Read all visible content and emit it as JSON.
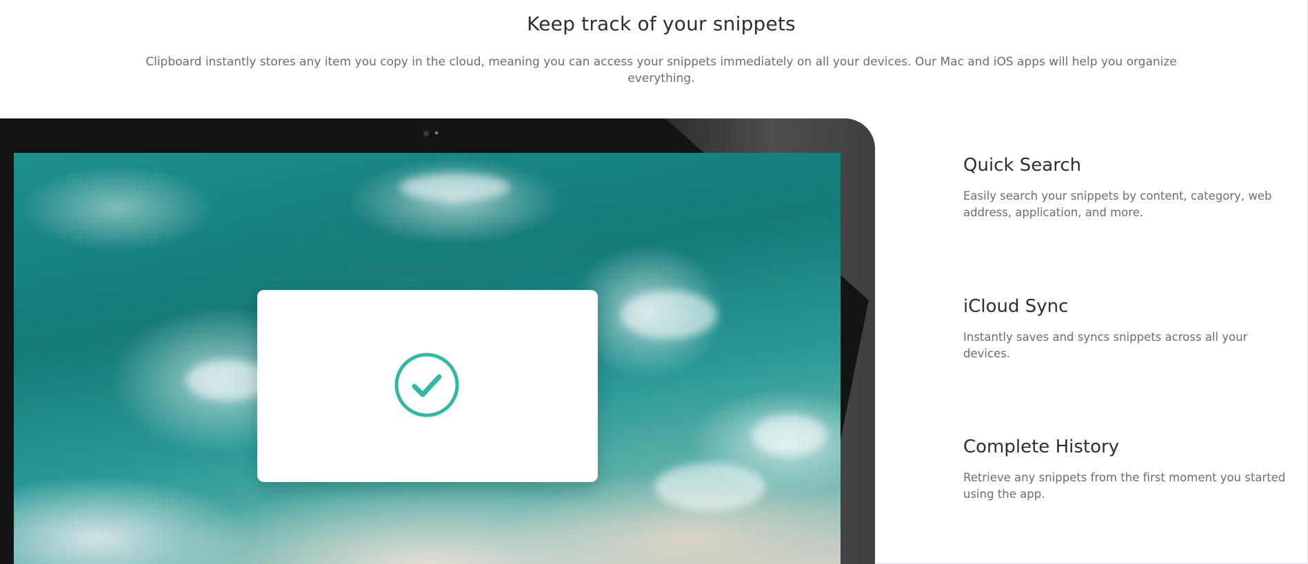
{
  "section": {
    "title": "Keep track of your snippets",
    "subtitle": "Clipboard instantly stores any item you copy in the cloud, meaning you can access your snippets immediately on all your devices. Our Mac and iOS apps will help you organize everything."
  },
  "mockup": {
    "device": "monitor",
    "modal_icon": "check-circle-icon",
    "accent_color": "#2fb9a4"
  },
  "features": [
    {
      "title": "Quick Search",
      "description": "Easily search your snippets by content, category, web address, application, and more."
    },
    {
      "title": "iCloud Sync",
      "description": "Instantly saves and syncs snippets across all your devices."
    },
    {
      "title": "Complete History",
      "description": "Retrieve any snippets from the first moment you started using the app."
    }
  ]
}
